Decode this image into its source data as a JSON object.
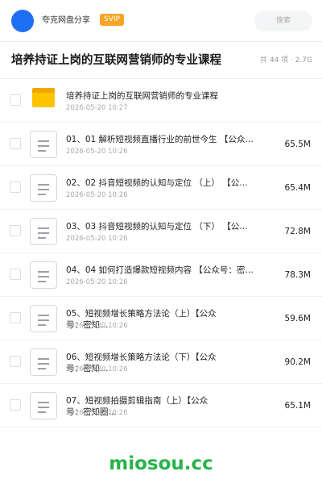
{
  "header": {
    "username": "夸克网盘分享",
    "badge": "SVIP",
    "search_placeholder": "搜索"
  },
  "title_bar": {
    "title": "培养持证上岗的互联网营销师的专业课程",
    "summary": "共 44 项 · 2.7G"
  },
  "files": [
    {
      "type": "folder",
      "name": "培养持证上岗的互联网营销师的专业课程",
      "date": "2026-05-20 10:27",
      "size": ""
    },
    {
      "type": "file",
      "name": "01、01 解析短视频直播行业的前世今生 【公众…",
      "date": "2026-05-20 10:26",
      "size": "65.5M"
    },
    {
      "type": "file",
      "name": "02、02 抖音短视频的认知与定位 （上） 【公…",
      "date": "2026-05-20 10:26",
      "size": "65.4M"
    },
    {
      "type": "file",
      "name": "03、03 抖音短视频的认知与定位 （下） 【公…",
      "date": "2026-05-20 10:26",
      "size": "72.8M"
    },
    {
      "type": "file",
      "name": "04、04 如何打造爆款短视频内容 【公众号：密…",
      "date": "2026-05-20 10:26",
      "size": "78.3M"
    },
    {
      "type": "file",
      "name": "05、短视频增长策略方法论（上）【公众号：密知…",
      "date": "2026-05-20 10:26",
      "size": "59.6M"
    },
    {
      "type": "file",
      "name": "06、短视频增长策略方法论（下）【公众号：密知…",
      "date": "2026-05-20 10:26",
      "size": "90.2M"
    },
    {
      "type": "file",
      "name": "07、短视频拍摄剪辑指南（上）【公众号：密知圈…",
      "date": "2026-05-20 10:26",
      "size": "65.1M"
    }
  ],
  "watermark": "miosou.cc"
}
